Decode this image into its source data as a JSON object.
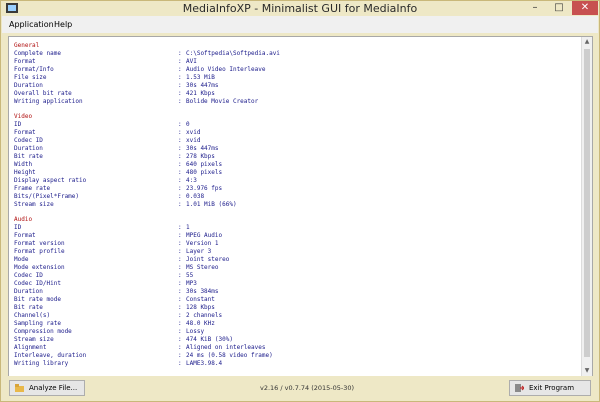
{
  "window": {
    "title": "MediaInfoXP - Minimalist GUI for MediaInfo",
    "min_label": "–",
    "max_label": "□",
    "close_label": "✕"
  },
  "menu": {
    "items": [
      "Application",
      "Help"
    ]
  },
  "report": {
    "sections": [
      {
        "name": "General",
        "rows": [
          {
            "k": "Complete name",
            "v": "C:\\Softpedia\\Softpedia.avi"
          },
          {
            "k": "Format",
            "v": "AVI"
          },
          {
            "k": "Format/Info",
            "v": "Audio Video Interleave"
          },
          {
            "k": "File size",
            "v": "1.53 MiB"
          },
          {
            "k": "Duration",
            "v": "30s 447ms"
          },
          {
            "k": "Overall bit rate",
            "v": "421 Kbps"
          },
          {
            "k": "Writing application",
            "v": "Bolide Movie Creator"
          }
        ]
      },
      {
        "name": "Video",
        "rows": [
          {
            "k": "ID",
            "v": "0"
          },
          {
            "k": "Format",
            "v": "xvid"
          },
          {
            "k": "Codec ID",
            "v": "xvid"
          },
          {
            "k": "Duration",
            "v": "30s 447ms"
          },
          {
            "k": "Bit rate",
            "v": "278 Kbps"
          },
          {
            "k": "Width",
            "v": "640 pixels"
          },
          {
            "k": "Height",
            "v": "480 pixels"
          },
          {
            "k": "Display aspect ratio",
            "v": "4:3"
          },
          {
            "k": "Frame rate",
            "v": "23.976 fps"
          },
          {
            "k": "Bits/(Pixel*Frame)",
            "v": "0.038"
          },
          {
            "k": "Stream size",
            "v": "1.01 MiB (66%)"
          }
        ]
      },
      {
        "name": "Audio",
        "rows": [
          {
            "k": "ID",
            "v": "1"
          },
          {
            "k": "Format",
            "v": "MPEG Audio"
          },
          {
            "k": "Format version",
            "v": "Version 1"
          },
          {
            "k": "Format profile",
            "v": "Layer 3"
          },
          {
            "k": "Mode",
            "v": "Joint stereo"
          },
          {
            "k": "Mode extension",
            "v": "MS Stereo"
          },
          {
            "k": "Codec ID",
            "v": "55"
          },
          {
            "k": "Codec ID/Hint",
            "v": "MP3"
          },
          {
            "k": "Duration",
            "v": "30s 384ms"
          },
          {
            "k": "Bit rate mode",
            "v": "Constant"
          },
          {
            "k": "Bit rate",
            "v": "128 Kbps"
          },
          {
            "k": "Channel(s)",
            "v": "2 channels"
          },
          {
            "k": "Sampling rate",
            "v": "48.0 KHz"
          },
          {
            "k": "Compression mode",
            "v": "Lossy"
          },
          {
            "k": "Stream size",
            "v": "474 KiB (30%)"
          },
          {
            "k": "Alignment",
            "v": "Aligned on interleaves"
          },
          {
            "k": "Interleave, duration",
            "v": "24 ms (0.58 video frame)"
          },
          {
            "k": "Writing library",
            "v": "LAME3.98.4"
          }
        ]
      }
    ]
  },
  "footer": {
    "analyze_label": "Analyze File...",
    "version": "v2.16 / v0.7.74 (2015-05-30)",
    "exit_label": "Exit Program"
  },
  "colors": {
    "section": "#b01010",
    "text": "#1a1a8a",
    "window": "#eee8c6"
  },
  "icons": {
    "title": "mediainfo-app-icon",
    "analyze": "analyze-file-icon",
    "exit": "exit-program-icon"
  }
}
